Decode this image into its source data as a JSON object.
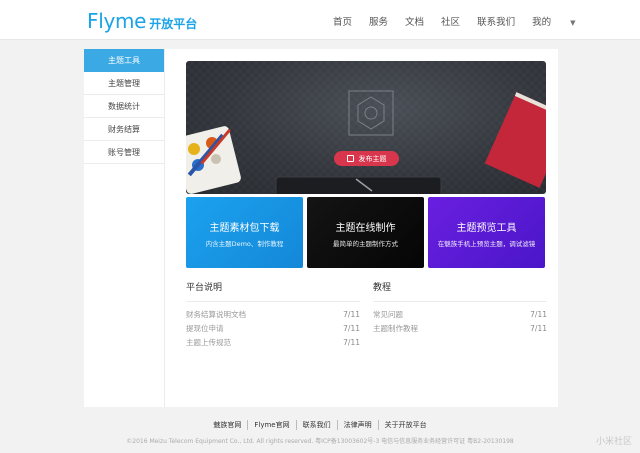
{
  "header": {
    "logo_word": "Flyme",
    "logo_sub": "开放平台",
    "nav": [
      "首页",
      "服务",
      "文档",
      "社区",
      "联系我们"
    ],
    "nav_user": "我的",
    "nav_user_icon": "caret-down"
  },
  "sidebar": {
    "items": [
      {
        "label": "主题工具"
      },
      {
        "label": "主题管理"
      },
      {
        "label": "数据统计"
      },
      {
        "label": "财务结算"
      },
      {
        "label": "账号管理"
      }
    ],
    "active_index": 0
  },
  "hero": {
    "button_label": "发布主题",
    "button_icon": "edit-icon",
    "colors": {
      "button": "#d7364c"
    }
  },
  "tiles": [
    {
      "title": "主题素材包下载",
      "subtitle": "内含主题Demo、制作教程",
      "color": "#1ba2ee"
    },
    {
      "title": "主题在线制作",
      "subtitle": "最简单的主题制作方式",
      "color": "#0d0d0d"
    },
    {
      "title": "主题预览工具",
      "subtitle": "在魅族手机上预览主题，调试滤镜",
      "color": "#5a1ad8"
    }
  ],
  "lists": {
    "left": {
      "title": "平台说明",
      "rows": [
        {
          "text": "财务结算说明文档",
          "date": "7/11"
        },
        {
          "text": "提现位申请",
          "date": "7/11"
        },
        {
          "text": "主题上传规范",
          "date": "7/11"
        }
      ]
    },
    "right": {
      "title": "教程",
      "rows": [
        {
          "text": "常见问题",
          "date": "7/11"
        },
        {
          "text": "主题制作教程",
          "date": "7/11"
        }
      ]
    }
  },
  "footer": {
    "links": [
      "魅族官网",
      "Flyme官网",
      "联系我们",
      "法律声明",
      "关于开放平台"
    ],
    "copyright": "©2016 Meizu Telecom Equipment Co., Ltd. All rights reserved. 粤ICP备13003602号-3 电信与信息服务业务经营许可证 粤B2-20130198"
  },
  "watermark": "小米社区"
}
